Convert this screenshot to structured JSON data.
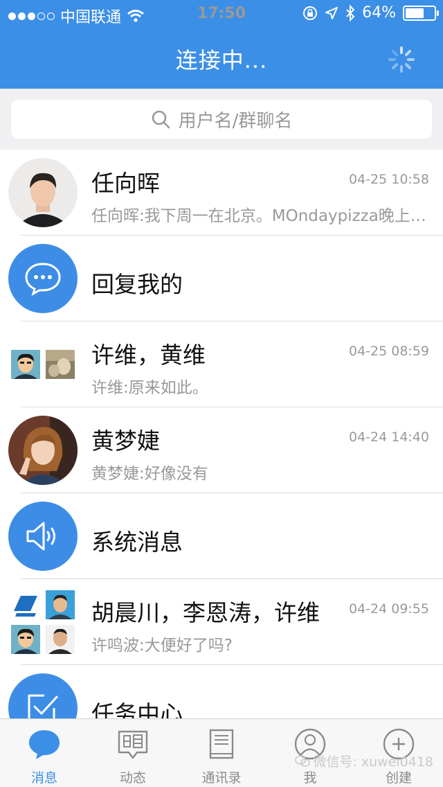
{
  "status_bar": {
    "carrier": "中国联通",
    "time": "17:50",
    "battery": "64%",
    "battery_level": 0.64
  },
  "header": {
    "title": "连接中..."
  },
  "search": {
    "placeholder": "用户名/群聊名"
  },
  "conversations": [
    {
      "name": "任向晖",
      "time": "04-25 10:58",
      "preview": "任向晖:我下周一在北京。MOndaypizza晚上…",
      "avatar": "photo"
    },
    {
      "name": "回复我的",
      "time": "",
      "preview": "",
      "avatar": "chat-bubble-icon"
    },
    {
      "name": "许维，黄维",
      "time": "04-25 08:59",
      "preview": "许维:原来如此。",
      "avatar": "group-2"
    },
    {
      "name": "黄梦婕",
      "time": "04-24 14:40",
      "preview": "黄梦婕:好像没有",
      "avatar": "photo"
    },
    {
      "name": "系统消息",
      "time": "",
      "preview": "",
      "avatar": "speaker-icon"
    },
    {
      "name": "胡晨川，李恩涛，许维",
      "time": "04-24 09:55",
      "preview": "许鸣波:大便好了吗?",
      "avatar": "group-4"
    },
    {
      "name": "任务中心",
      "time": "",
      "preview": "",
      "avatar": "task-icon"
    }
  ],
  "tabs": [
    {
      "label": "消息",
      "icon": "message-icon",
      "active": true
    },
    {
      "label": "动态",
      "icon": "news-icon",
      "active": false
    },
    {
      "label": "通讯录",
      "icon": "contacts-icon",
      "active": false
    },
    {
      "label": "我",
      "icon": "profile-icon",
      "active": false
    },
    {
      "label": "创建",
      "icon": "create-icon",
      "active": false
    }
  ],
  "watermark": "微信号: xuwei0418",
  "colors": {
    "accent": "#3c8fe6",
    "secondary_text": "#999999"
  }
}
